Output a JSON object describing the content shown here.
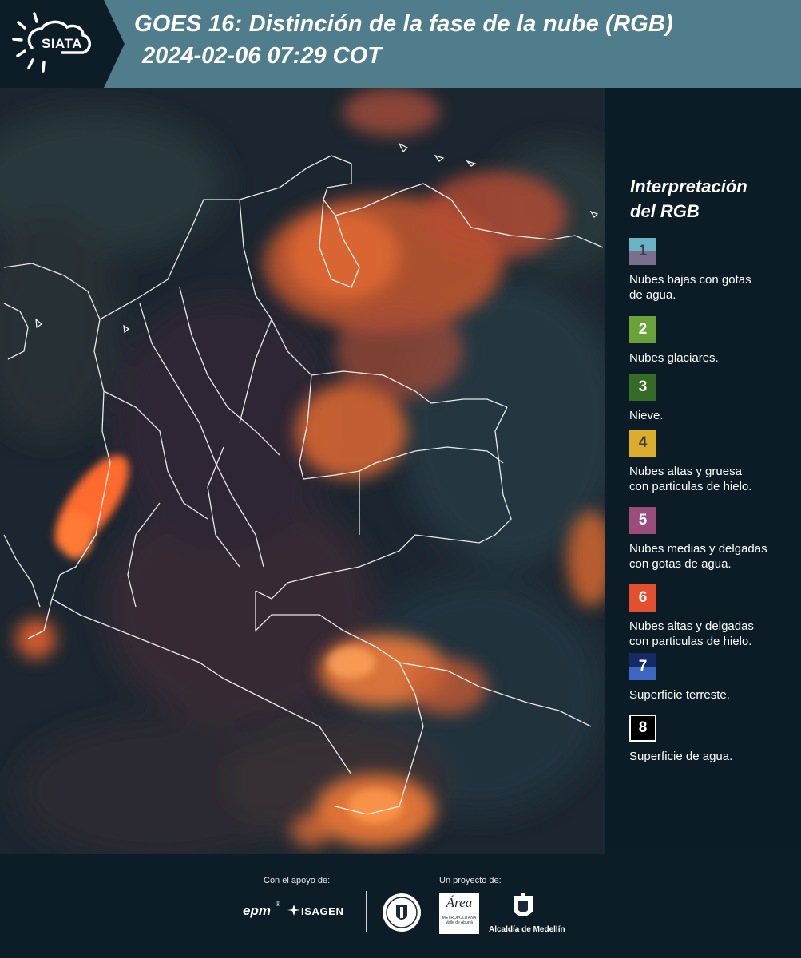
{
  "header": {
    "logo_text": "SIATA",
    "title_line1": "GOES 16: Distinción de la fase de la nube (RGB)",
    "title_line2": "2024-02-06 07:29 COT"
  },
  "legend": {
    "title_line1": "Interpretación",
    "title_line2": "del RGB",
    "items": [
      {
        "number": "1",
        "label_line1": "Nubes bajas con gotas",
        "label_line2": "de agua.",
        "color_top": "#69b3c2",
        "color_bottom": "#7a6f8c",
        "num_color": "#3a3a4a"
      },
      {
        "number": "2",
        "label_line1": "Nubes glaciares.",
        "label_line2": "",
        "color_top": "#6aa23a",
        "color_bottom": "#6aa23a",
        "num_color": "#ffffff"
      },
      {
        "number": "3",
        "label_line1": "Nieve.",
        "label_line2": "",
        "color_top": "#356b25",
        "color_bottom": "#356b25",
        "num_color": "#ffffff"
      },
      {
        "number": "4",
        "label_line1": "Nubes altas y gruesa",
        "label_line2": "con particulas de hielo.",
        "color_top": "#dcad2a",
        "color_bottom": "#dcad2a",
        "num_color": "#3c3c3c"
      },
      {
        "number": "5",
        "label_line1": "Nubes medias y delgadas",
        "label_line2": "con gotas de agua.",
        "color_top": "#9c4c7a",
        "color_bottom": "#9c4c7a",
        "num_color": "#ffffff"
      },
      {
        "number": "6",
        "label_line1": "Nubes altas y delgadas",
        "label_line2": "con particulas de hielo.",
        "color_top": "#e3502f",
        "color_bottom": "#e3502f",
        "num_color": "#ffffff"
      },
      {
        "number": "7",
        "label_line1": "Superficie terreste.",
        "label_line2": "",
        "color_top": "#142a66",
        "color_bottom": "#3c66bf",
        "num_color": "#ffffff"
      },
      {
        "number": "8",
        "label_line1": "Superficie de agua.",
        "label_line2": "",
        "color_top": "#000000",
        "color_bottom": "#000000",
        "num_color": "#ffffff"
      }
    ]
  },
  "footer": {
    "support_label": "Con el apoyo de:",
    "project_label": "Un proyecto de:",
    "sponsor1": "epm",
    "sponsor2": "ISAGEN",
    "partner_area_line1": "Área",
    "partner_area_line2": "METROPOLITANA",
    "partner_area_line3": "Valle de Aburrá",
    "partner_alcaldia": "Alcaldía de Medellín"
  }
}
